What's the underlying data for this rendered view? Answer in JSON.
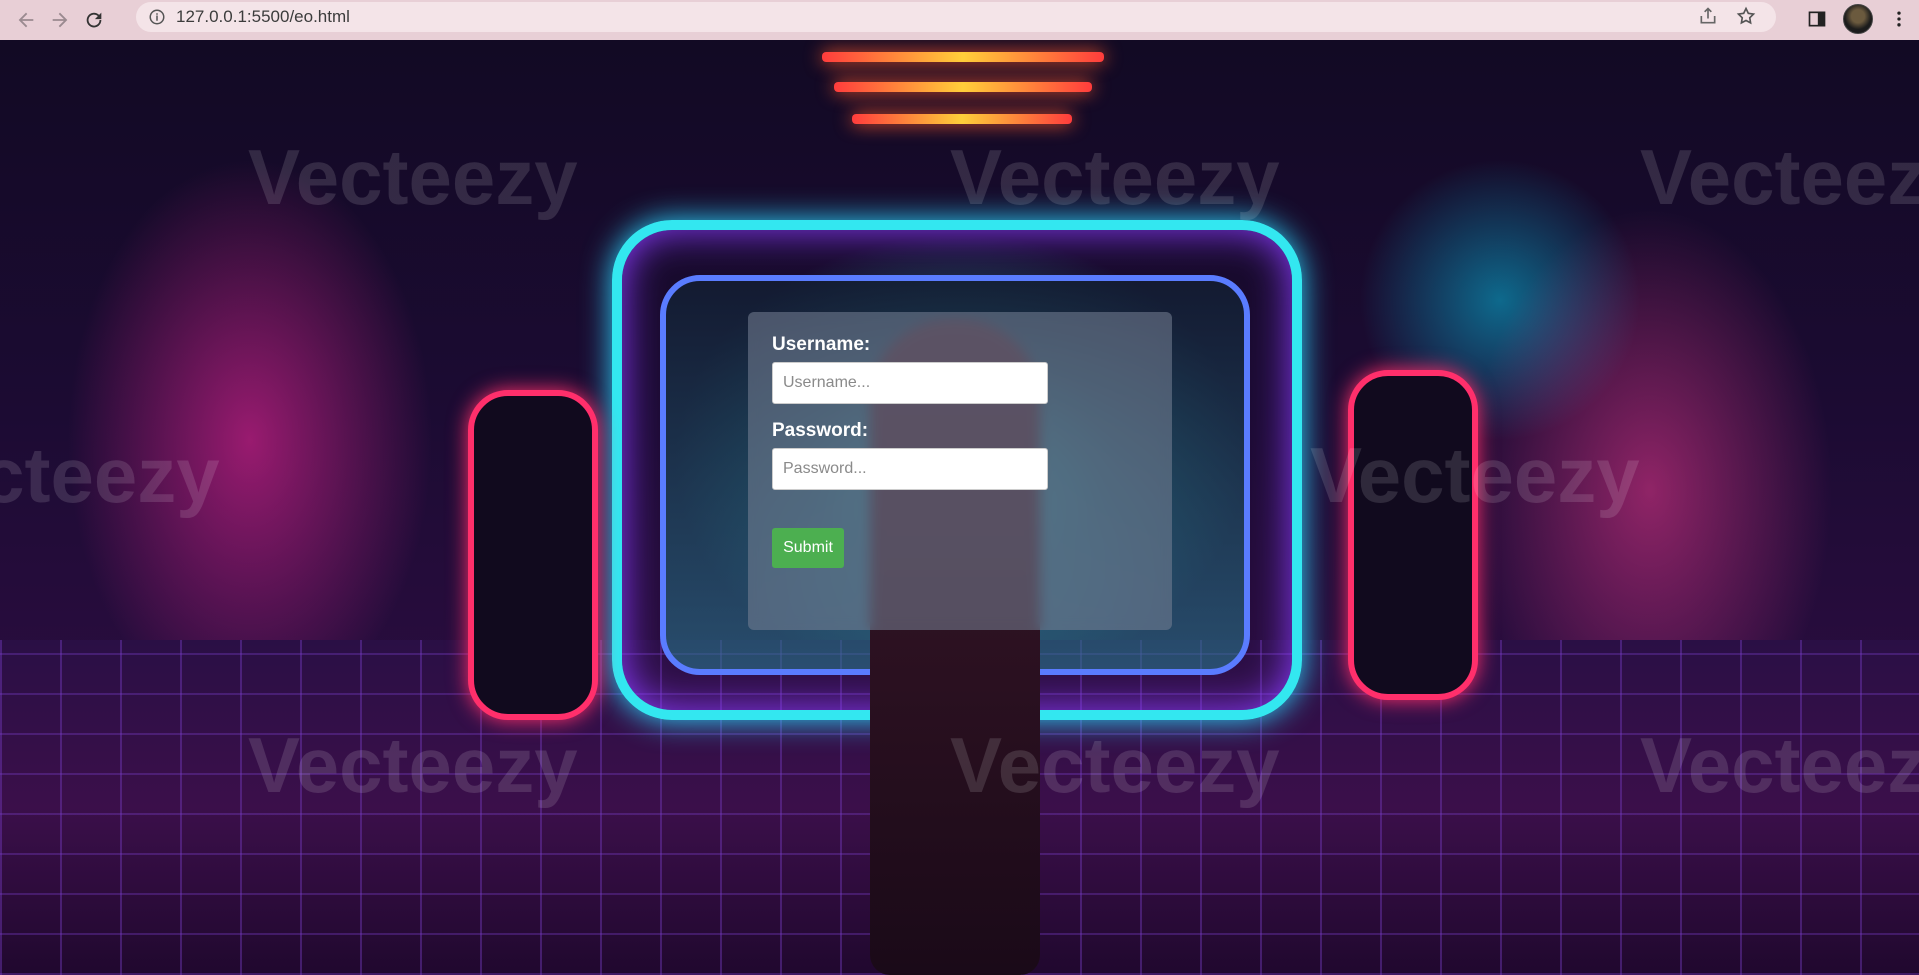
{
  "browser": {
    "url": "127.0.0.1:5500/eo.html"
  },
  "background": {
    "watermark_text": "Vecteezy",
    "accent_colors": [
      "#ff2b74",
      "#33e7f0",
      "#ff3c3c",
      "#5a7cff"
    ]
  },
  "login": {
    "username_label": "Username:",
    "username_placeholder": "Username...",
    "username_value": "",
    "password_label": "Password:",
    "password_placeholder": "Password...",
    "password_value": "",
    "submit_label": "Submit",
    "submit_color": "#4caf50"
  },
  "icons": {
    "back": "arrow-left-icon",
    "forward": "arrow-right-icon",
    "reload": "reload-icon",
    "info": "info-icon",
    "share": "share-icon",
    "bookmark": "star-icon",
    "sidebar": "side-panel-icon",
    "menu": "more-vertical-icon"
  }
}
